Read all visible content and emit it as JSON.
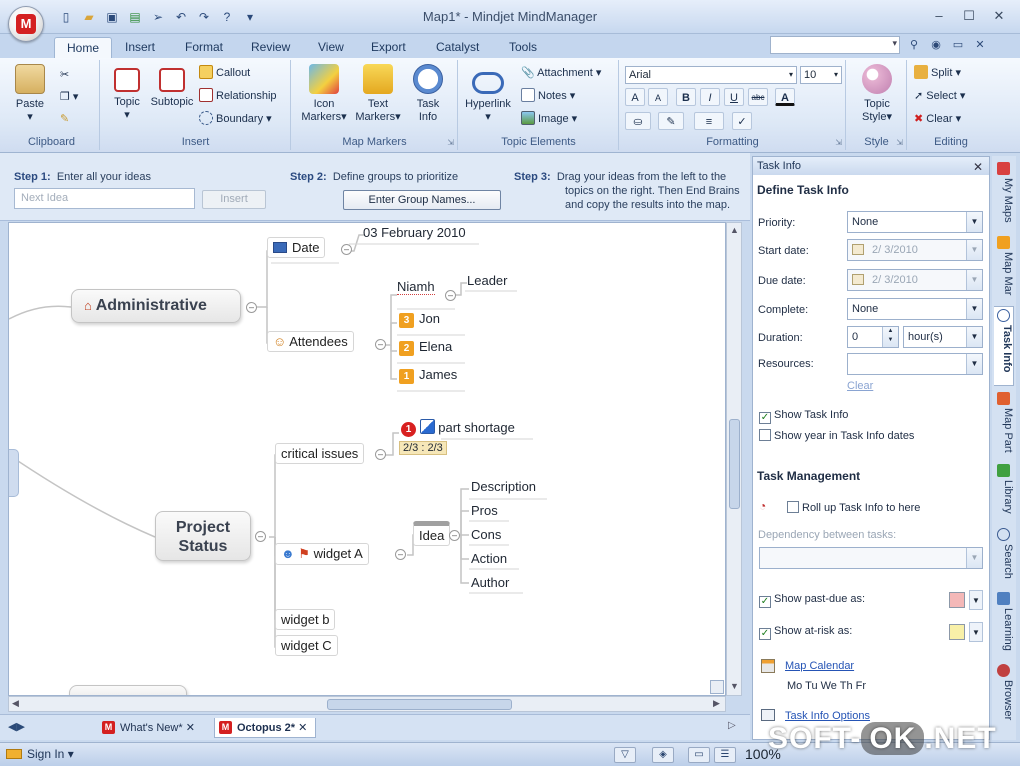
{
  "window": {
    "title": "Map1* - Mindjet MindManager",
    "controls": [
      "–",
      "☐",
      "✕"
    ]
  },
  "tabs": [
    "Home",
    "Insert",
    "Format",
    "Review",
    "View",
    "Export",
    "Catalyst",
    "Tools"
  ],
  "ribbon": {
    "clipboard": {
      "label": "Clipboard",
      "paste": "Paste"
    },
    "insert": {
      "label": "Insert",
      "topic": "Topic",
      "subtopic": "Subtopic",
      "callout": "Callout",
      "relationship": "Relationship",
      "boundary": "Boundary"
    },
    "markers": {
      "label": "Map Markers",
      "icon_markers_1": "Icon",
      "icon_markers_2": "Markers",
      "text_markers_1": "Text",
      "text_markers_2": "Markers",
      "task_info_1": "Task",
      "task_info_2": "Info"
    },
    "elements": {
      "label": "Topic Elements",
      "hyperlink": "Hyperlink",
      "attachment": "Attachment",
      "notes": "Notes",
      "image": "Image"
    },
    "formatting": {
      "label": "Formatting",
      "font": "Arial",
      "size": "10",
      "bold": "B",
      "italic": "I",
      "underline": "U",
      "strike": "abc",
      "grow": "A",
      "shrink": "A",
      "color": "A"
    },
    "style": {
      "label": "Style",
      "topic_style_1": "Topic",
      "topic_style_2": "Style"
    },
    "editing": {
      "label": "Editing",
      "split": "Split",
      "select": "Select",
      "clear": "Clear"
    }
  },
  "brainstorm": {
    "step1_label": "Step 1:",
    "step1_text": "Enter all your ideas",
    "step2_label": "Step 2:",
    "step2_text": "Define groups to prioritize",
    "step3_label": "Step 3:",
    "step3_line1": "Drag your ideas from the left to the",
    "step3_line2": "topics on the right. Then End Brains",
    "step3_line3": "and copy the results into the map.",
    "idea_placeholder": "Next Idea",
    "insert_btn": "Insert",
    "group_btn": "Enter Group Names..."
  },
  "map": {
    "administrative": "Administrative",
    "date": "Date",
    "date_value": "03 February 2010",
    "attendees": "Attendees",
    "niamh": "Niamh",
    "leader": "Leader",
    "jon": "Jon",
    "jon_rank": "3",
    "elena": "Elena",
    "elena_rank": "2",
    "james": "James",
    "james_rank": "1",
    "project_status_1": "Project",
    "project_status_2": "Status",
    "critical_issues": "critical issues",
    "part_shortage": "part shortage",
    "part_priority": "1",
    "progress_tag": "2/3 : 2/3",
    "widget_a": "widget A",
    "idea": "Idea",
    "description": "Description",
    "pros": "Pros",
    "cons": "Cons",
    "action": "Action",
    "author": "Author",
    "widget_b": "widget b",
    "widget_c": "widget C"
  },
  "doc_tabs": [
    "What's New*",
    "Octopus 2*"
  ],
  "task_pane": {
    "title": "Task Info",
    "header": "Define Task Info",
    "priority_label": "Priority:",
    "priority_value": "None",
    "start_label": "Start date:",
    "start_value": "2/ 3/2010",
    "due_label": "Due date:",
    "due_value": "2/ 3/2010",
    "complete_label": "Complete:",
    "complete_value": "None",
    "duration_label": "Duration:",
    "duration_value": "0",
    "duration_unit": "hour(s)",
    "resources_label": "Resources:",
    "clear_link": "Clear",
    "show_task_info": "Show Task Info",
    "show_year": "Show year in Task Info dates",
    "task_mgmt": "Task Management",
    "rollup": "Roll up Task Info to here",
    "dependency": "Dependency between tasks:",
    "past_due": "Show past-due as:",
    "at_risk": "Show at-risk as:",
    "past_due_color": "#f4b8b8",
    "at_risk_color": "#f8f0a8",
    "map_calendar": "Map Calendar",
    "weekdays": "Mo Tu We Th Fr",
    "task_options": "Task Info Options"
  },
  "side_tabs": [
    "My Maps",
    "Map Mar",
    "Task Info",
    "Map Part",
    "Library",
    "Search",
    "Learning",
    "Browser"
  ],
  "status": {
    "sign_in": "Sign In",
    "zoom": "100%"
  },
  "watermark": {
    "left": "SOFT-",
    "ok": "OK",
    "right": ".NET"
  }
}
